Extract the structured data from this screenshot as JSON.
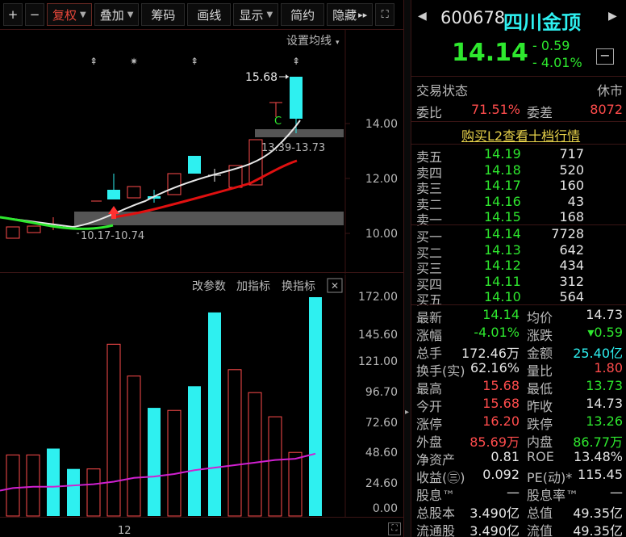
{
  "toolbar": {
    "zoom_in": "+",
    "zoom_out": "−",
    "fuquan": "复权",
    "overlay": "叠加",
    "chips": "筹码",
    "draw": "画线",
    "display": "显示",
    "simple": "简约",
    "hide": "隐藏",
    "hide_arrows": "▸▸",
    "fullscreen": "⛶"
  },
  "kline": {
    "ma_setting": "设置均线",
    "high_label": "15.68",
    "low_label": "10.17-10.74",
    "zone_label": "13.39-13.73",
    "c_marker": "C",
    "y_ticks": [
      "14.00",
      "12.00",
      "10.00"
    ],
    "star_markers": [
      "⇞",
      "✷",
      "⇞",
      "⇞"
    ]
  },
  "volume": {
    "modify_params": "改参数",
    "add_indicator": "加指标",
    "switch_indicator": "换指标",
    "close": "✕",
    "y_ticks": [
      "172.00",
      "145.60",
      "121.00",
      "96.70",
      "72.60",
      "48.60",
      "24.60",
      "0.00"
    ]
  },
  "xaxis": {
    "label": "12"
  },
  "quote": {
    "code": "600678",
    "name": "四川金顶",
    "price": "14.14",
    "change": "- 0.59",
    "change_pct": "- 4.01%",
    "collapse": "−",
    "status_label": "交易状态",
    "status_value": "休市",
    "weibi_label": "委比",
    "weibi_value": "71.51%",
    "weicha_label": "委差",
    "weicha_value": "8072",
    "l2_link": "购买L2查看十档行情",
    "sell": [
      {
        "label": "卖五",
        "price": "14.19",
        "vol": "717"
      },
      {
        "label": "卖四",
        "price": "14.18",
        "vol": "520"
      },
      {
        "label": "卖三",
        "price": "14.17",
        "vol": "160"
      },
      {
        "label": "卖二",
        "price": "14.16",
        "vol": "43"
      },
      {
        "label": "卖一",
        "price": "14.15",
        "vol": "168"
      }
    ],
    "buy": [
      {
        "label": "买一",
        "price": "14.14",
        "vol": "7728"
      },
      {
        "label": "买二",
        "price": "14.13",
        "vol": "642"
      },
      {
        "label": "买三",
        "price": "14.12",
        "vol": "434"
      },
      {
        "label": "买四",
        "price": "14.11",
        "vol": "312"
      },
      {
        "label": "买五",
        "price": "14.10",
        "vol": "564"
      }
    ],
    "stats": [
      {
        "l1": "最新",
        "v1": "14.14",
        "c1": "green",
        "l2": "均价",
        "v2": "14.73",
        "c2": "white"
      },
      {
        "l1": "涨幅",
        "v1": "-4.01%",
        "c1": "green",
        "l2": "涨跌",
        "v2": "▾0.59",
        "c2": "green"
      },
      {
        "l1": "总手",
        "v1": "172.46万",
        "c1": "white",
        "l2": "金额",
        "v2": "25.40亿",
        "c2": "cyan"
      },
      {
        "l1": "换手(实)",
        "v1": "62.16%",
        "c1": "white",
        "l2": "量比",
        "v2": "1.80",
        "c2": "red"
      },
      {
        "l1": "最高",
        "v1": "15.68",
        "c1": "red",
        "l2": "最低",
        "v2": "13.73",
        "c2": "green"
      },
      {
        "l1": "今开",
        "v1": "15.68",
        "c1": "red",
        "l2": "昨收",
        "v2": "14.73",
        "c2": "white"
      },
      {
        "l1": "涨停",
        "v1": "16.20",
        "c1": "red",
        "l2": "跌停",
        "v2": "13.26",
        "c2": "green"
      },
      {
        "l1": "外盘",
        "v1": "85.69万",
        "c1": "red",
        "l2": "内盘",
        "v2": "86.77万",
        "c2": "green"
      },
      {
        "l1": "净资产",
        "v1": "0.81",
        "c1": "white",
        "l2": "ROE",
        "v2": "13.48%",
        "c2": "white"
      },
      {
        "l1": "收益(㊂)",
        "v1": "0.092",
        "c1": "white",
        "l2": "PE(动)*",
        "v2": "115.45",
        "c2": "white"
      },
      {
        "l1": "股息™",
        "v1": "—",
        "c1": "white",
        "l2": "股息率™",
        "v2": "—",
        "c2": "white"
      },
      {
        "l1": "总股本",
        "v1": "3.490亿",
        "c1": "white",
        "l2": "总值",
        "v2": "49.35亿",
        "c2": "white"
      },
      {
        "l1": "流通股",
        "v1": "3.490亿",
        "c1": "white",
        "l2": "流值",
        "v2": "49.35亿",
        "c2": "white"
      }
    ]
  },
  "chart_data": {
    "type": "bar",
    "title": "",
    "ylim": [
      0,
      172
    ],
    "values": [
      48,
      48,
      53,
      37,
      37,
      135,
      110,
      85,
      83,
      102,
      160,
      115,
      97,
      78,
      50,
      172
    ],
    "colors": [
      "up",
      "up",
      "down",
      "down",
      "up",
      "up",
      "up",
      "down",
      "up",
      "down",
      "down",
      "up",
      "up",
      "up",
      "up",
      "down"
    ],
    "ma": [
      22,
      23,
      23,
      24,
      25,
      27,
      30,
      31,
      33,
      36,
      38,
      40,
      42,
      44,
      45,
      49
    ]
  }
}
